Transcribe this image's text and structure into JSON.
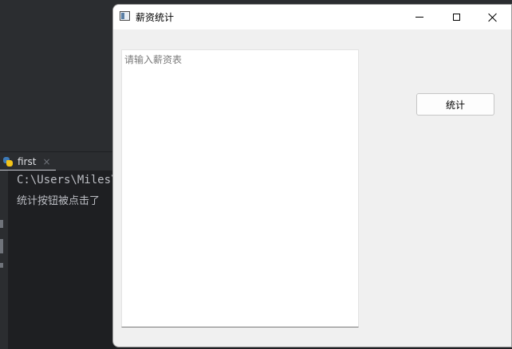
{
  "ide": {
    "run_tab_label": "first",
    "run_tab_close": "×",
    "console_lines": [
      "C:\\Users\\Miles\\",
      "统计按钮被点击了"
    ]
  },
  "window": {
    "title": "薪资统计",
    "textarea": {
      "placeholder": "请输入薪资表",
      "value": ""
    },
    "stat_button_label": "统计"
  },
  "icons": [
    "python-icon",
    "app-window-icon",
    "minimize-icon",
    "maximize-icon",
    "close-icon"
  ]
}
